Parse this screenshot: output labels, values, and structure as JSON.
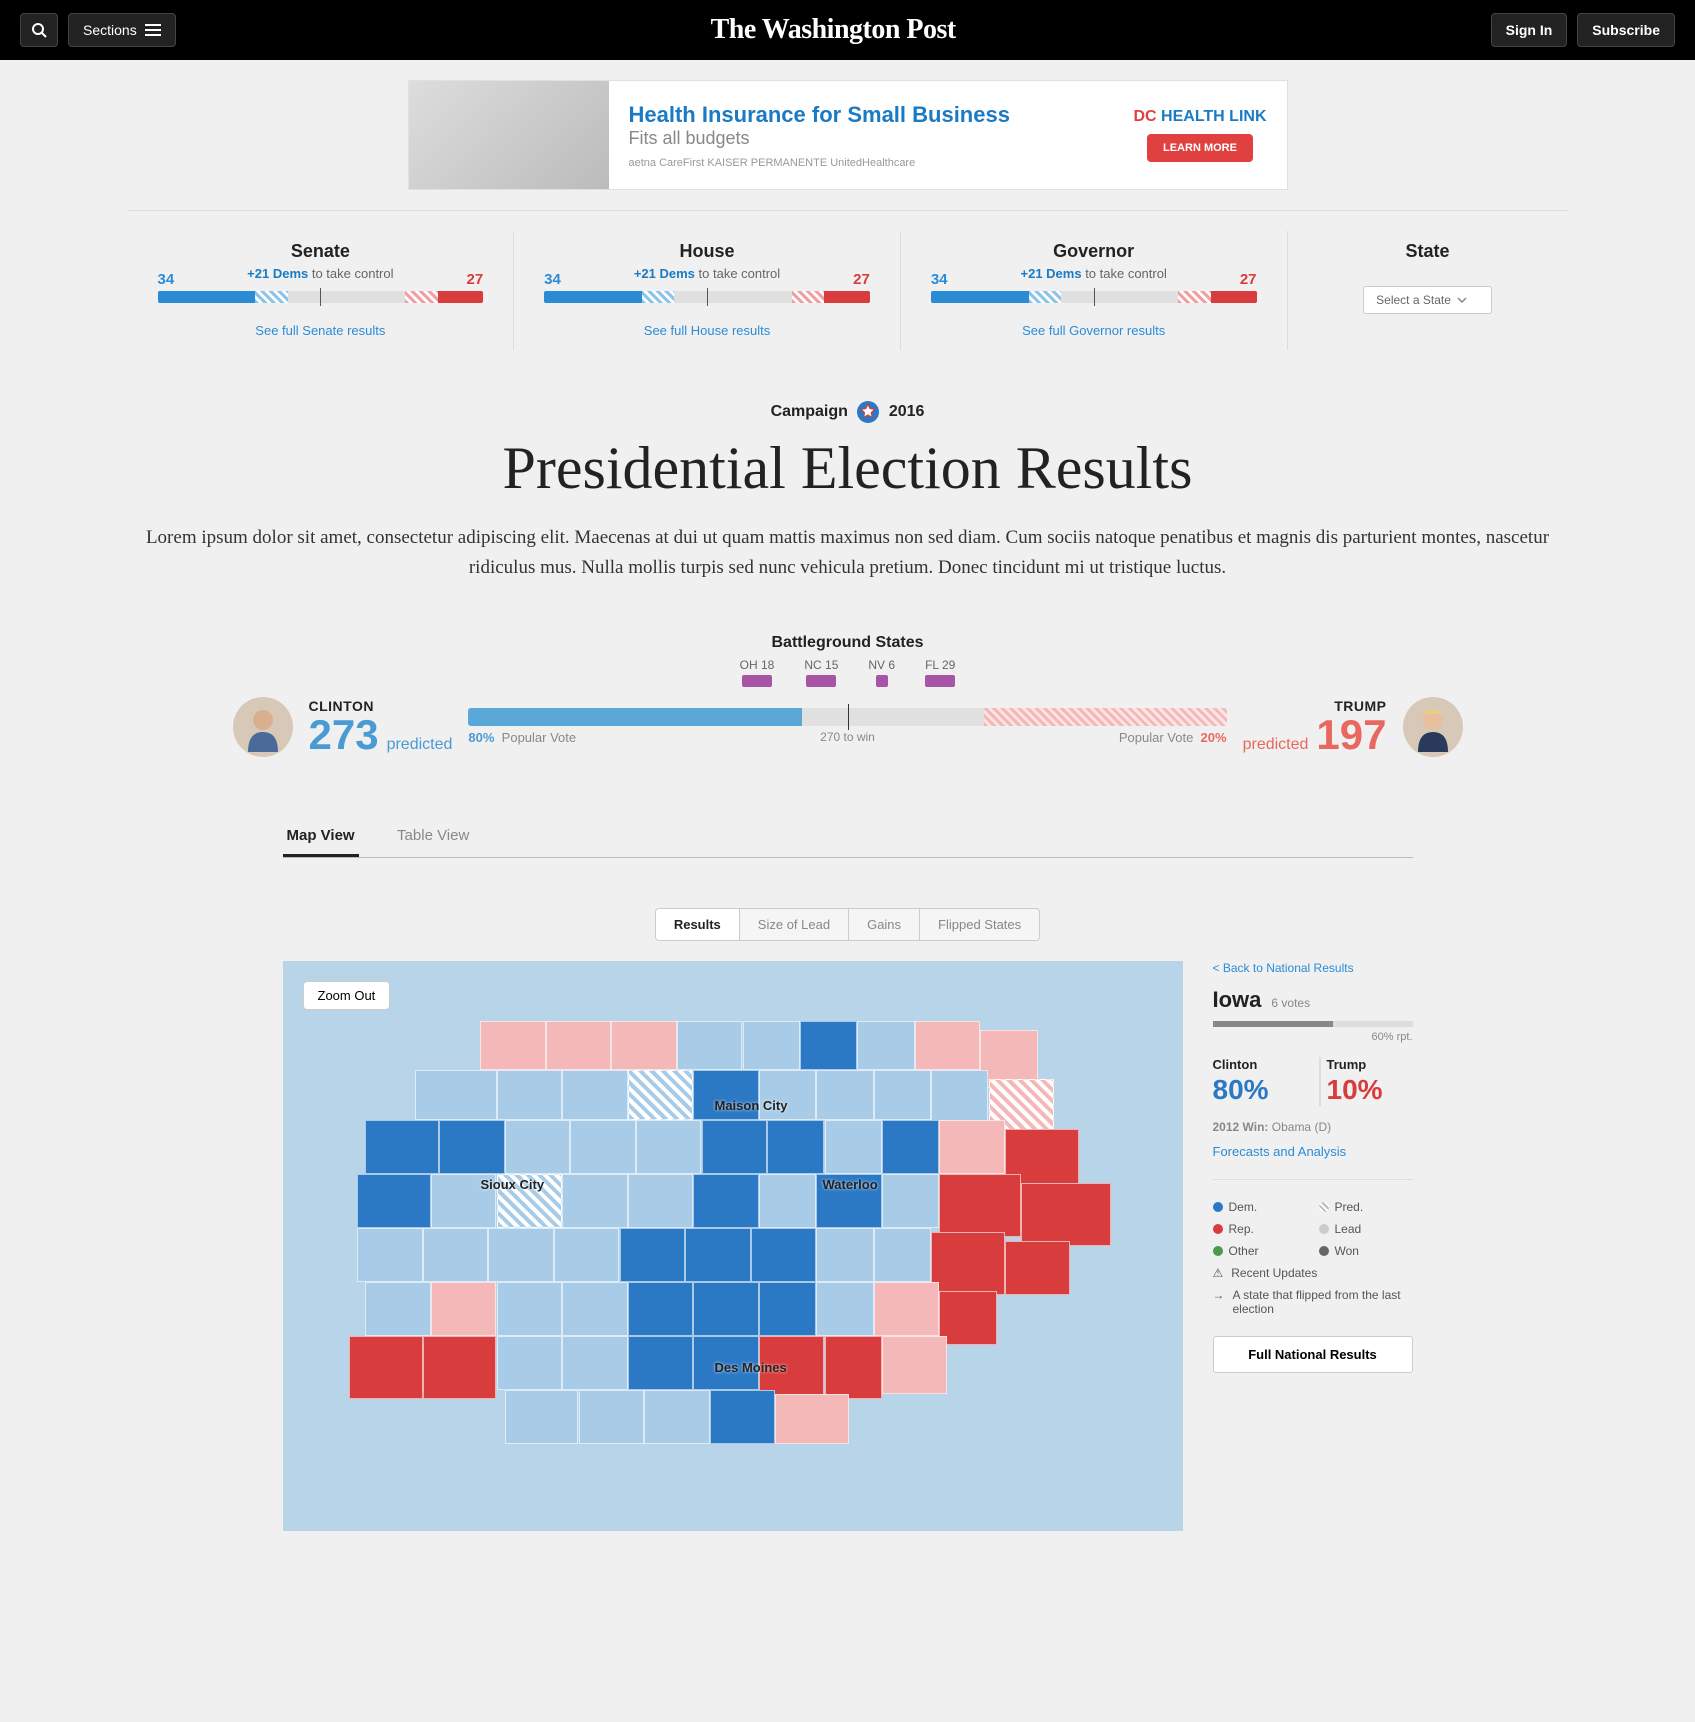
{
  "header": {
    "sections": "Sections",
    "masthead": "The Washington Post",
    "signin": "Sign In",
    "subscribe": "Subscribe"
  },
  "ad": {
    "title": "Health Insurance for Small Business",
    "subtitle": "Fits all budgets",
    "logos": "aetna  CareFirst  KAISER PERMANENTE  UnitedHealthcare",
    "brand_pre": "DC",
    "brand_post": "HEALTH LINK",
    "cta": "LEARN MORE"
  },
  "summary": {
    "senate": {
      "title": "Senate",
      "sub_num": "+21 Dems",
      "sub_text": " to take control",
      "left": "34",
      "right": "27",
      "link": "See full Senate results"
    },
    "house": {
      "title": "House",
      "sub_num": "+21 Dems",
      "sub_text": " to take control",
      "left": "34",
      "right": "27",
      "link": "See full House results"
    },
    "governor": {
      "title": "Governor",
      "sub_num": "+21 Dems",
      "sub_text": " to take control",
      "left": "34",
      "right": "27",
      "link": "See full Governor results"
    },
    "state": {
      "title": "State",
      "select": "Select a State"
    }
  },
  "campaign": {
    "pre": "Campaign",
    "post": "2016"
  },
  "title": "Presidential Election Results",
  "lede": "Lorem ipsum dolor sit amet, consectetur adipiscing elit. Maecenas at dui ut quam mattis maximus non sed diam. Cum sociis natoque penatibus et magnis dis parturient montes, nascetur ridiculus mus. Nulla mollis turpis sed nunc vehicula pretium. Donec tincidunt mi ut tristique luctus.",
  "prediction": {
    "bg_title": "Battleground States",
    "states": [
      {
        "abbr": "OH",
        "ev": "18"
      },
      {
        "abbr": "NC",
        "ev": "15"
      },
      {
        "abbr": "NV",
        "ev": "6"
      },
      {
        "abbr": "FL",
        "ev": "29"
      }
    ],
    "clinton": {
      "name": "CLINTON",
      "num": "273",
      "label": "predicted",
      "pop": "80%",
      "pop_label": "Popular Vote"
    },
    "trump": {
      "name": "TRUMP",
      "num": "197",
      "label": "predicted",
      "pop": "20%",
      "pop_label": "Popular Vote"
    },
    "center": "270 to win"
  },
  "tabs": {
    "map": "Map View",
    "table": "Table View"
  },
  "controls": {
    "results": "Results",
    "size": "Size of Lead",
    "gains": "Gains",
    "flipped": "Flipped States"
  },
  "map": {
    "zoom": "Zoom Out",
    "cities": {
      "sioux": "Sioux City",
      "mason": "Maison City",
      "waterloo": "Waterloo",
      "desmoines": "Des Moines"
    }
  },
  "side": {
    "back": "< Back to National Results",
    "state": "Iowa",
    "votes": "6 votes",
    "rpt": "60% rpt.",
    "clinton": {
      "name": "Clinton",
      "pct": "80%"
    },
    "trump": {
      "name": "Trump",
      "pct": "10%"
    },
    "prev_label": "2012 Win:",
    "prev_val": " Obama (D)",
    "forecast": "Forecasts and Analysis",
    "legend": {
      "dem": "Dem.",
      "rep": "Rep.",
      "other": "Other",
      "pred": "Pred.",
      "lead": "Lead",
      "won": "Won",
      "recent": "Recent Updates",
      "flipped": "A state that flipped from the last election"
    },
    "full_btn": "Full National Results"
  },
  "chart_data": [
    {
      "type": "bar",
      "title": "Senate",
      "categories": [
        "Dem",
        "Rep"
      ],
      "values": [
        34,
        27
      ],
      "note": "+21 Dems to take control"
    },
    {
      "type": "bar",
      "title": "House",
      "categories": [
        "Dem",
        "Rep"
      ],
      "values": [
        34,
        27
      ],
      "note": "+21 Dems to take control"
    },
    {
      "type": "bar",
      "title": "Governor",
      "categories": [
        "Dem",
        "Rep"
      ],
      "values": [
        34,
        27
      ],
      "note": "+21 Dems to take control"
    },
    {
      "type": "bar",
      "title": "Electoral Votes Predicted",
      "categories": [
        "Clinton",
        "Trump"
      ],
      "values": [
        273,
        197
      ],
      "note": "270 to win",
      "battleground": {
        "OH": 18,
        "NC": 15,
        "NV": 6,
        "FL": 29
      }
    },
    {
      "type": "bar",
      "title": "Popular Vote",
      "categories": [
        "Clinton",
        "Trump"
      ],
      "values": [
        80,
        20
      ],
      "ylabel": "%"
    },
    {
      "type": "bar",
      "title": "Iowa Results",
      "categories": [
        "Clinton",
        "Trump"
      ],
      "values": [
        80,
        10
      ],
      "ylabel": "%",
      "note": "60% reporting, 6 electoral votes, 2012 Win: Obama (D)"
    }
  ]
}
